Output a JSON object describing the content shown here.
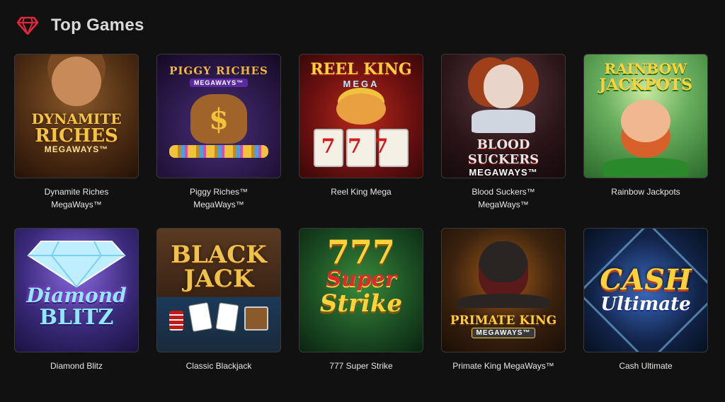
{
  "header": {
    "title": "Top Games",
    "icon": "diamond-icon",
    "icon_color": "#e0283b"
  },
  "games": [
    {
      "name": "Dynamite Riches MegaWays™",
      "art_line1": "DYNAMITE",
      "art_line2": "RICHES",
      "art_line3": "MEGAWAYS™",
      "bg": "#4a2a12",
      "accent": "#f5c542"
    },
    {
      "name": "Piggy Riches™ MegaWays™",
      "art_line1": "PIGGY",
      "art_line2": "RICHES",
      "art_line3": "MEGAWAYS™",
      "bg": "#2a1a4a",
      "accent": "#f4b93a"
    },
    {
      "name": "Reel King Mega",
      "art_line1": "REEL KING",
      "art_line2": "MEGA",
      "art_line3": "777",
      "bg": "#6a1010",
      "accent": "#ffd23a"
    },
    {
      "name": "Blood Suckers™ MegaWays™",
      "art_line1": "BLOOD",
      "art_line2": "SUCKERS",
      "art_line3": "MEGAWAYS™",
      "bg": "#2a1418",
      "accent": "#e6e6e6"
    },
    {
      "name": "Rainbow Jackpots",
      "art_line1": "RAINBOW",
      "art_line2": "JACKPOTS",
      "art_line3": "",
      "bg": "#3a7a3a",
      "accent": "#ffd23a"
    },
    {
      "name": "Diamond Blitz",
      "art_line1": "Diamond",
      "art_line2": "BLITZ",
      "art_line3": "",
      "bg": "#3a2a7a",
      "accent": "#8fe8ff"
    },
    {
      "name": "Classic Blackjack",
      "art_line1": "BLACK",
      "art_line2": "JACK",
      "art_line3": "",
      "bg": "#3a2a1a",
      "accent": "#f0c24a"
    },
    {
      "name": "777 Super Strike",
      "art_line1": "777",
      "art_line2": "Super",
      "art_line3": "Strike",
      "bg": "#1a4a22",
      "accent": "#ffd23a"
    },
    {
      "name": "Primate King MegaWays™",
      "art_line1": "PRIMATE KING",
      "art_line2": "MEGAWAYS™",
      "art_line3": "",
      "bg": "#3a220e",
      "accent": "#ffcc33"
    },
    {
      "name": "Cash Ultimate",
      "art_line1": "CASH",
      "art_line2": "Ultimate",
      "art_line3": "",
      "bg": "#12244a",
      "accent": "#ffd23a"
    }
  ]
}
